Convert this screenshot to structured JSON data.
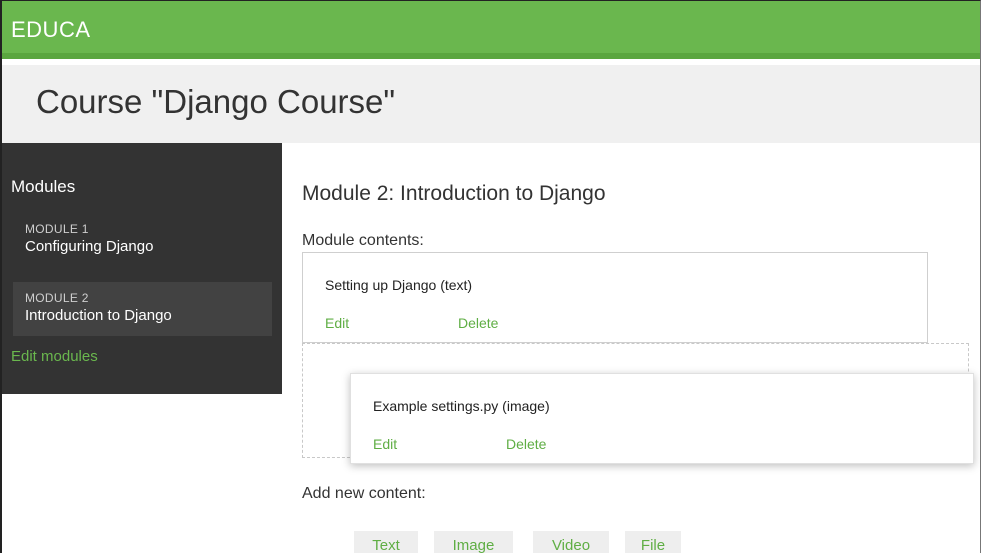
{
  "header": {
    "brand": "EDUCA"
  },
  "course": {
    "title": "Course \"Django Course\""
  },
  "sidebar": {
    "heading": "Modules",
    "modules": [
      {
        "number": "MODULE 1",
        "name": "Configuring Django",
        "active": false
      },
      {
        "number": "MODULE 2",
        "name": "Introduction to Django",
        "active": true
      }
    ],
    "edit_modules": "Edit modules"
  },
  "main": {
    "title": "Module 2: Introduction to Django",
    "contents_label": "Module contents:",
    "contents": [
      {
        "title": "Setting up Django (text)",
        "edit": "Edit",
        "delete": "Delete"
      },
      {
        "title": "Example settings.py (image)",
        "edit": "Edit",
        "delete": "Delete"
      }
    ],
    "add_label": "Add new content:",
    "add_buttons": [
      "Text",
      "Image",
      "Video",
      "File"
    ]
  },
  "colors": {
    "accent": "#6ab74e",
    "sidebar_bg": "#333333",
    "sidebar_active": "#424242",
    "header_bg": "#f0f0f0"
  }
}
